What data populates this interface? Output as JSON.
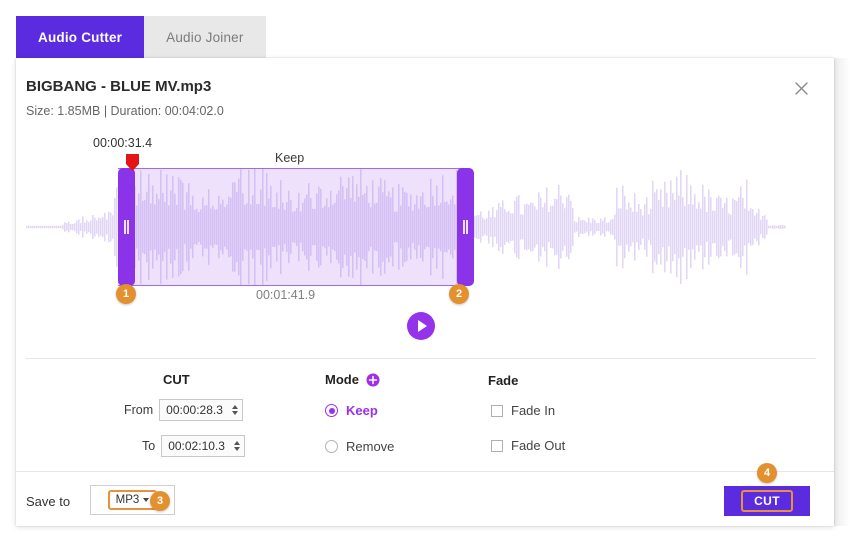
{
  "tabs": [
    {
      "label": "Audio Cutter",
      "active": true
    },
    {
      "label": "Audio Joiner",
      "active": false
    }
  ],
  "file": {
    "title": "BIGBANG - BLUE MV.mp3",
    "meta": "Size: 1.85MB | Duration: 00:04:02.0"
  },
  "close_icon": "close-icon",
  "waveform": {
    "playhead_time": "00:00:31.4",
    "selection_label": "Keep",
    "selection_duration": "00:01:41.9",
    "play_icon": "play-icon",
    "handle_left_badge": "1",
    "handle_right_badge": "2",
    "selection_fill": "#a76af0",
    "handle_color": "#8b33e8",
    "wave_color": "#e2d6f7",
    "playhead_color": "#e31414"
  },
  "cut": {
    "title": "CUT",
    "from_label": "From",
    "from_value": "00:00:28.3",
    "to_label": "To",
    "to_value": "00:02:10.3"
  },
  "mode": {
    "title": "Mode",
    "add_icon": "plus-circle-icon",
    "options": [
      {
        "label": "Keep",
        "selected": true
      },
      {
        "label": "Remove",
        "selected": false
      }
    ]
  },
  "fade": {
    "title": "Fade",
    "options": [
      {
        "label": "Fade In",
        "checked": false
      },
      {
        "label": "Fade Out",
        "checked": false
      }
    ]
  },
  "footer": {
    "save_to_label": "Save to",
    "format_value": "MP3",
    "format_badge": "3",
    "cut_button_label": "CUT",
    "cut_badge": "4"
  },
  "colors": {
    "accent_blue_purple": "#5b2be0",
    "accent_purple": "#9b30e8",
    "badge_orange": "#e3912f",
    "highlight_orange": "#e8903a"
  }
}
